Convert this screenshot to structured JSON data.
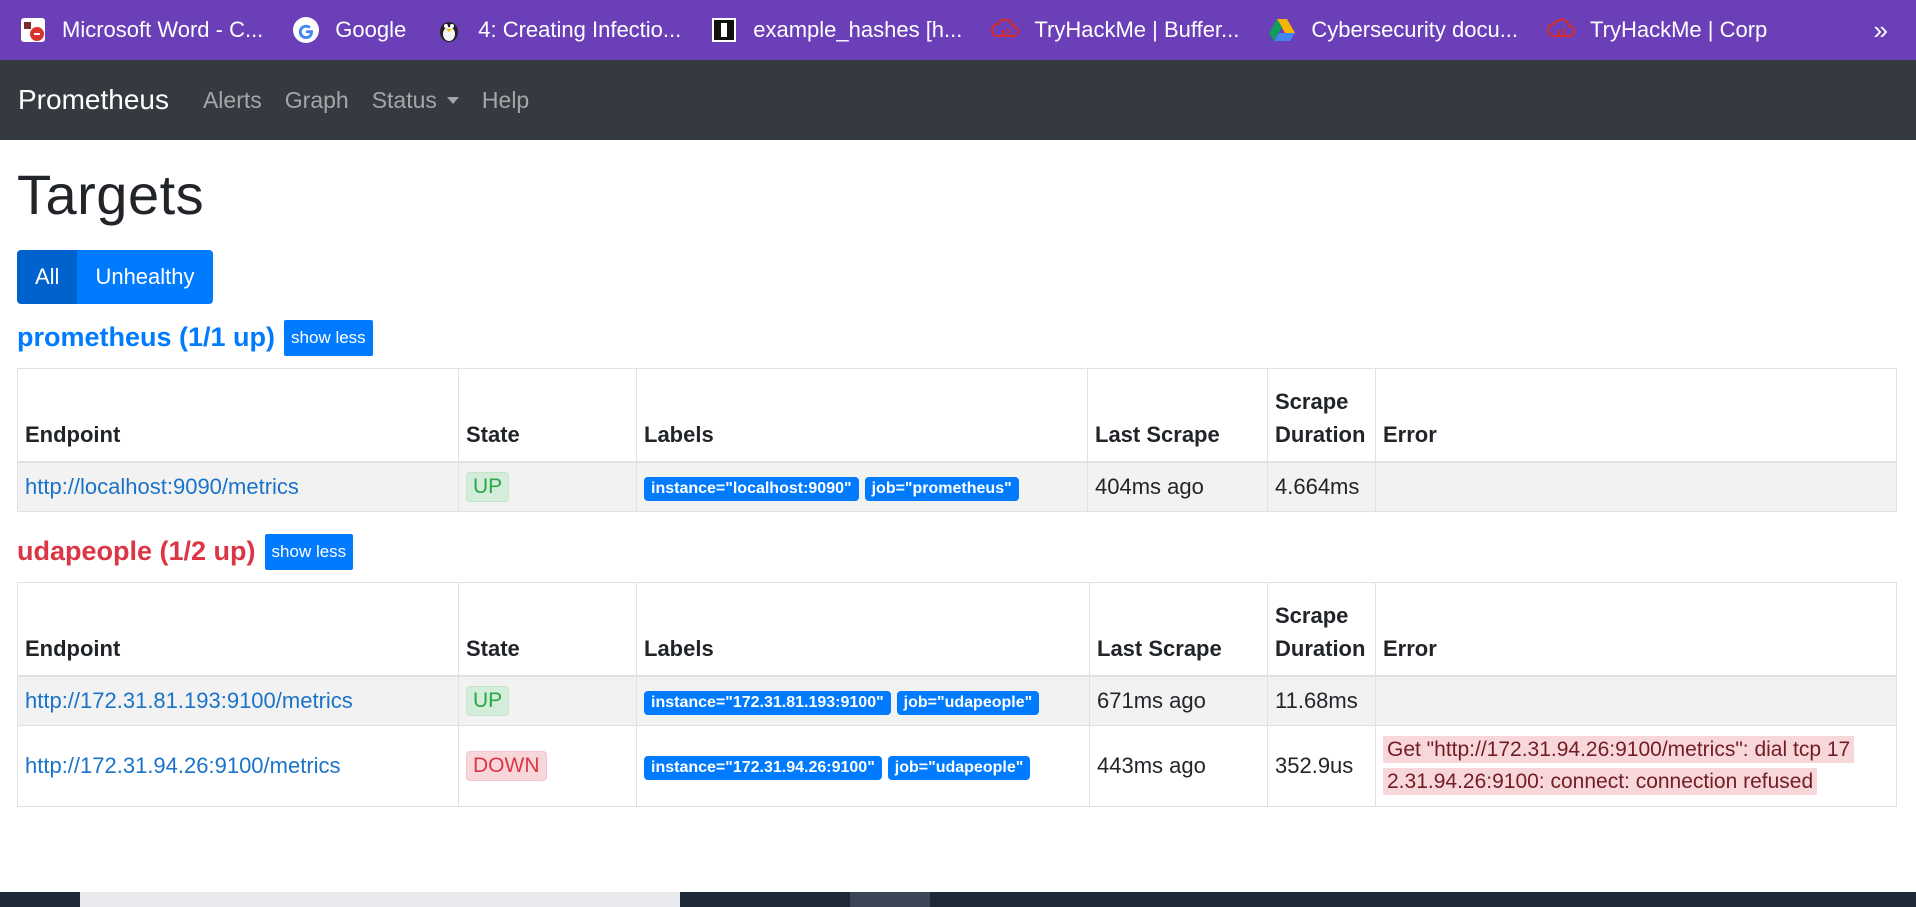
{
  "bookmarks": [
    {
      "label": "Microsoft Word - C...",
      "icon": "word-icon"
    },
    {
      "label": "Google",
      "icon": "google-icon"
    },
    {
      "label": "4: Creating Infectio...",
      "icon": "penguin-icon"
    },
    {
      "label": "example_hashes [h...",
      "icon": "hashcat-icon"
    },
    {
      "label": "TryHackMe | Buffer...",
      "icon": "tryhackme-icon"
    },
    {
      "label": "Cybersecurity docu...",
      "icon": "drive-icon"
    },
    {
      "label": "TryHackMe | Corp",
      "icon": "tryhackme-icon"
    }
  ],
  "bookmarks_more": "»",
  "navbar": {
    "brand": "Prometheus",
    "links": [
      "Alerts",
      "Graph",
      "Status",
      "Help"
    ]
  },
  "page": {
    "title": "Targets",
    "filters": {
      "all": "All",
      "unhealthy": "Unhealthy"
    }
  },
  "headers": {
    "endpoint": "Endpoint",
    "state": "State",
    "labels": "Labels",
    "last_scrape": "Last Scrape",
    "scrape_duration_1": "Scrape",
    "scrape_duration_2": "Duration",
    "error": "Error"
  },
  "jobs": [
    {
      "title": "prometheus (1/1 up)",
      "show_less": "show less",
      "targets": [
        {
          "endpoint": "http://localhost:9090/metrics",
          "state": "UP",
          "labels": [
            "instance=\"localhost:9090\"",
            "job=\"prometheus\""
          ],
          "last_scrape": "404ms ago",
          "duration": "4.664ms",
          "error": ""
        }
      ]
    },
    {
      "title": "udapeople (1/2 up)",
      "show_less": "show less",
      "targets": [
        {
          "endpoint": "http://172.31.81.193:9100/metrics",
          "state": "UP",
          "labels": [
            "instance=\"172.31.81.193:9100\"",
            "job=\"udapeople\""
          ],
          "last_scrape": "671ms ago",
          "duration": "11.68ms",
          "error": ""
        },
        {
          "endpoint": "http://172.31.94.26:9100/metrics",
          "state": "DOWN",
          "labels": [
            "instance=\"172.31.94.26:9100\"",
            "job=\"udapeople\""
          ],
          "last_scrape": "443ms ago",
          "duration": "352.9us",
          "error_line1": "Get \"http://172.31.94.26:9100/metrics\": dial tcp 17",
          "error_line2": "2.31.94.26:9100: connect: connection refused"
        }
      ]
    }
  ]
}
